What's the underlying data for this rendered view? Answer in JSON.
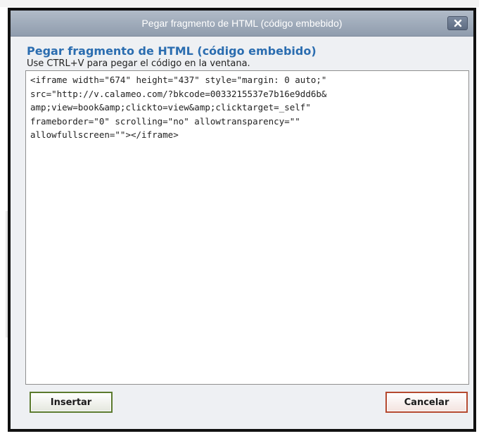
{
  "dialog": {
    "title": "Pegar fragmento de HTML (código embebido)",
    "heading": "Pegar fragmento de HTML (código embebido)",
    "instructions": "Use CTRL+V para pegar el código en la ventana.",
    "code": "<iframe width=\"674\" height=\"437\" style=\"margin: 0 auto;\"\nsrc=\"http://v.calameo.com/?bkcode=0033215537e7b16e9dd6b&\namp;view=book&amp;clickto=view&amp;clicktarget=_self\"\nframeborder=\"0\" scrolling=\"no\" allowtransparency=\"\"\nallowfullscreen=\"\"></iframe>",
    "insert_label": "Insertar",
    "cancel_label": "Cancelar",
    "close_icon": "close-icon"
  },
  "colors": {
    "heading": "#2b6db0",
    "titlebar_top": "#b1bbc8",
    "titlebar_bottom": "#8f9cad",
    "insert_border": "#5b7a2e",
    "cancel_border": "#b5492f"
  }
}
